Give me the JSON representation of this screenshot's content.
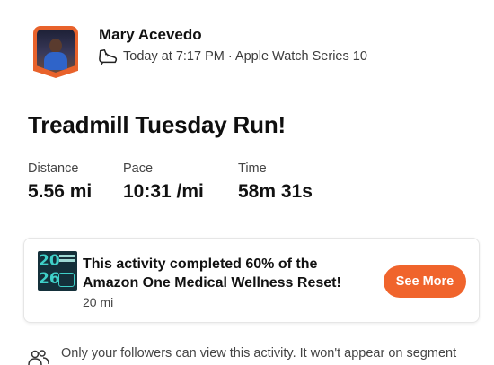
{
  "athlete": {
    "name": "Mary Acevedo",
    "meta": "Today at 7:17 PM · Apple Watch Series 10"
  },
  "activity": {
    "title": "Treadmill Tuesday Run!"
  },
  "stats": [
    {
      "label": "Distance",
      "value": "5.56 mi"
    },
    {
      "label": "Pace",
      "value": "10:31 /mi"
    },
    {
      "label": "Time",
      "value": "58m 31s"
    }
  ],
  "challenge": {
    "badge_top": "20",
    "badge_bottom": "26",
    "title": "This activity completed 60% of the Amazon One Medical Wellness Reset!",
    "progress_percent": 60,
    "distance": "20 mi",
    "button_label": "See More"
  },
  "privacy": {
    "text": "Only your followers can view this activity. It won't appear on segment leaderboards and may not count toward some challenges."
  },
  "colors": {
    "accent": "#f0642c",
    "badge_bg": "#14303a",
    "badge_text": "#3fd0c8"
  }
}
